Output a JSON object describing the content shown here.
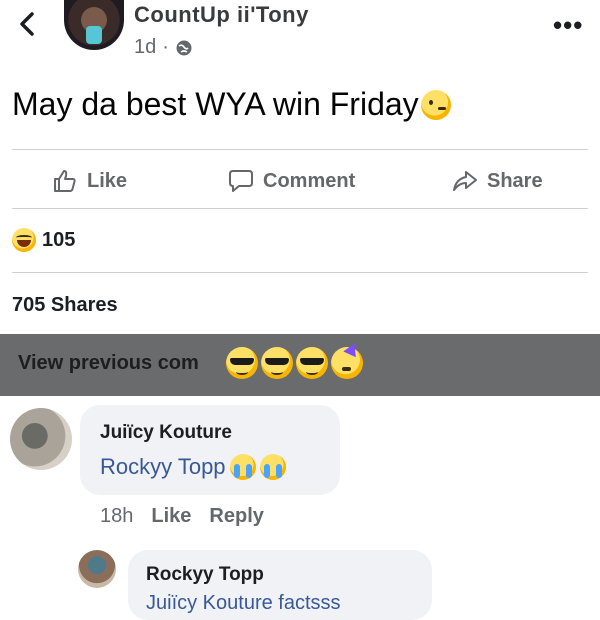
{
  "post": {
    "author": "CountUp ii'Tony",
    "time": "1d",
    "separator": "·",
    "text": "May da best WYA win Friday",
    "text_emoji": "woozy-face"
  },
  "actions": {
    "like": "Like",
    "comment": "Comment",
    "share": "Share"
  },
  "reactions": {
    "emoji": "laughing-face",
    "count": "105"
  },
  "shares": "705 Shares",
  "comments_banner": {
    "label": "View previous com",
    "emojis": [
      "sunglasses-face",
      "sunglasses-face",
      "sunglasses-face",
      "partying-face"
    ]
  },
  "comments": [
    {
      "author": "Juiïcy Kouture",
      "text": "Rockyy Topp",
      "emojis": [
        "crying-face",
        "crying-face"
      ],
      "time": "18h",
      "like": "Like",
      "reply": "Reply"
    },
    {
      "author": "Rockyy Topp",
      "text": "Juiïcy Kouture factsss"
    }
  ],
  "colors": {
    "link": "#385898",
    "muted": "#65676b",
    "bubble": "#f0f2f5",
    "banner": "#6a6b6c"
  }
}
